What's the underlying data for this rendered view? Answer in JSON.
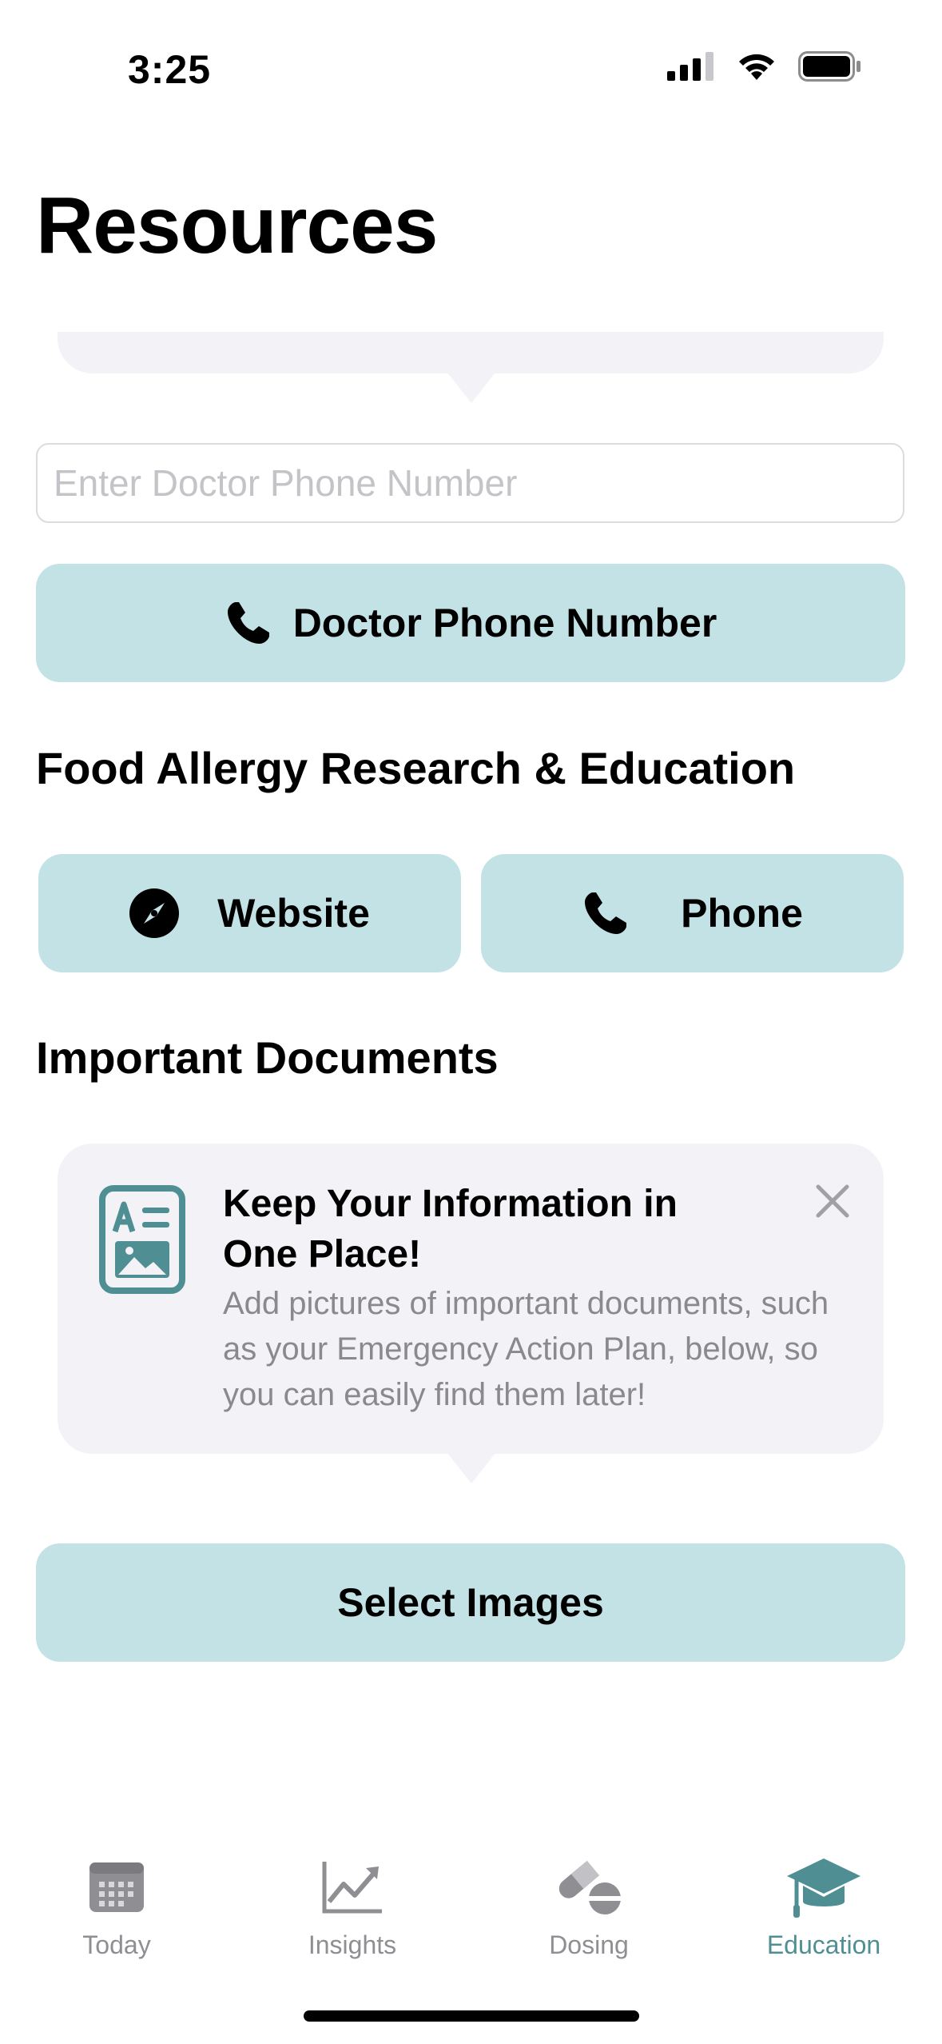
{
  "status_bar": {
    "time": "3:25"
  },
  "page": {
    "title": "Resources"
  },
  "doctor": {
    "input_placeholder": "Enter Doctor Phone Number",
    "input_value": "",
    "button_label": "Doctor Phone Number",
    "button_icon": "phone-icon"
  },
  "fare": {
    "heading": "Food Allergy Research & Education",
    "website_label": "Website",
    "website_icon": "compass-icon",
    "phone_label": "Phone",
    "phone_icon": "phone-icon"
  },
  "documents": {
    "heading": "Important Documents",
    "tip": {
      "title": "Keep Your Information in One Place!",
      "body": "Add pictures of important documents, such as your Emergency Action Plan, below, so you can easily find them later!",
      "icon": "document-image-icon"
    },
    "select_label": "Select Images"
  },
  "tabbar": {
    "tabs": [
      {
        "label": "Today",
        "icon": "calendar-icon",
        "active": false
      },
      {
        "label": "Insights",
        "icon": "chart-icon",
        "active": false
      },
      {
        "label": "Dosing",
        "icon": "pills-icon",
        "active": false
      },
      {
        "label": "Education",
        "icon": "graduation-cap-icon",
        "active": true
      }
    ]
  },
  "colors": {
    "button_bg": "#c3e2e6",
    "card_bg": "#f2f2f7",
    "accent": "#4f8f94",
    "inactive": "#8e8e93"
  }
}
